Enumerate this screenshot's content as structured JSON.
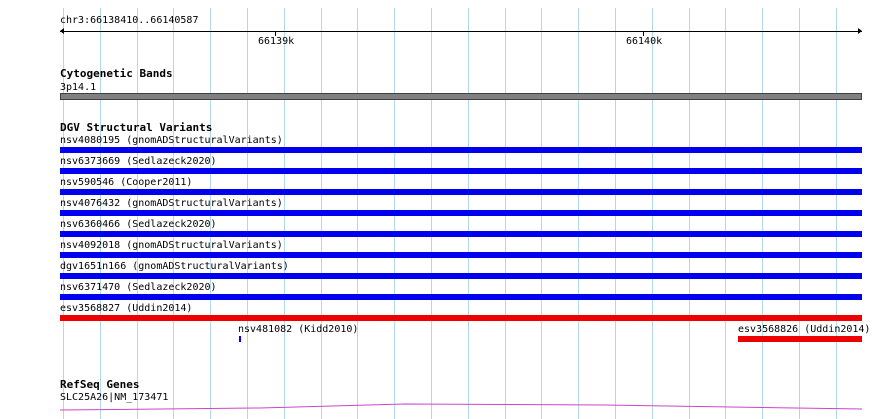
{
  "ruler": {
    "range_label": "chr3:66138410..66140587",
    "ticks": [
      {
        "label": "66139k"
      },
      {
        "label": "66140k"
      }
    ]
  },
  "colors": {
    "gridline": "#b3d9e8",
    "ruler": "#000000",
    "band": "#808080",
    "dgv_blue": "#0000ee",
    "dgv_red": "#ee0000",
    "refseq_line": "#cc44cc"
  },
  "tracks": {
    "cytoband": {
      "title": "Cytogenetic Bands",
      "label": "3p14.1"
    },
    "dgv": {
      "title": "DGV Structural Variants",
      "features": [
        {
          "label": "nsv4080195 (gnomADStructuralVariants)",
          "color": "blue"
        },
        {
          "label": "nsv6373669 (Sedlazeck2020)",
          "color": "blue"
        },
        {
          "label": "nsv590546 (Cooper2011)",
          "color": "blue"
        },
        {
          "label": "nsv4076432 (gnomADStructuralVariants)",
          "color": "blue"
        },
        {
          "label": "nsv6360466 (Sedlazeck2020)",
          "color": "blue"
        },
        {
          "label": "nsv4092018 (gnomADStructuralVariants)",
          "color": "blue"
        },
        {
          "label": "dgv1651n166 (gnomADStructuralVariants)",
          "color": "blue"
        },
        {
          "label": "nsv6371470 (Sedlazeck2020)",
          "color": "blue"
        },
        {
          "label": "esv3568827 (Uddin2014)",
          "color": "red"
        }
      ],
      "small_features": [
        {
          "label": "nsv481082 (Kidd2010)",
          "color": "blue"
        },
        {
          "label": "esv3568826 (Uddin2014)",
          "color": "red"
        }
      ]
    },
    "refseq": {
      "title": "RefSeq Genes",
      "gene_label": "SLC25A26|NM_173471"
    }
  }
}
